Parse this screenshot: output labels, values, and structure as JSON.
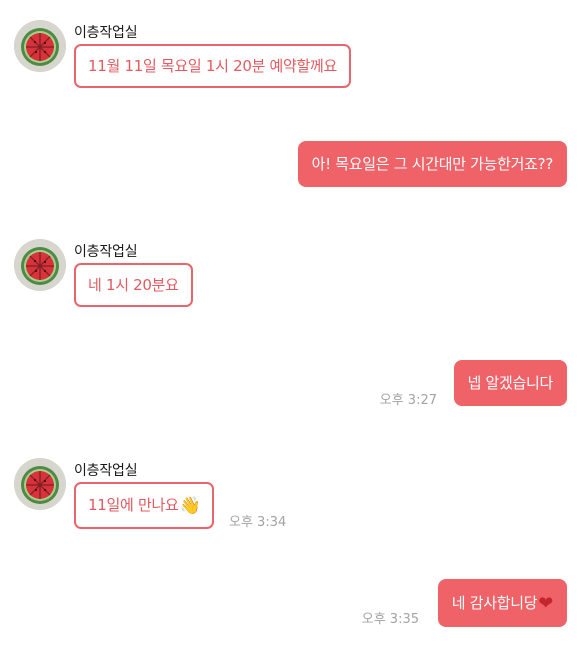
{
  "chat": {
    "sender_name": "이층작업실",
    "messages": [
      {
        "direction": "in",
        "text": "11월 11일 목요일 1시 20분 예약할께요",
        "time": ""
      },
      {
        "direction": "out",
        "text": "아! 목요일은 그 시간대만 가능한거죠??",
        "time": ""
      },
      {
        "direction": "in",
        "text": "네 1시 20분요",
        "time": ""
      },
      {
        "direction": "out",
        "text": "넵 알겠습니다",
        "time": "오후 3:27"
      },
      {
        "direction": "in",
        "text": "11일에 만나요",
        "emoji": "👋",
        "time": "오후 3:34"
      },
      {
        "direction": "out",
        "text": "네 감사합니당",
        "emoji": "❤",
        "time": "오후 3:35"
      }
    ]
  },
  "icons": {
    "avatar": "watermelon-profile-photo",
    "wave": "waving-hand-emoji",
    "heart": "red-heart-emoji"
  },
  "colors": {
    "outgoing_bubble": "#ee6268",
    "incoming_border": "#e8666b",
    "incoming_text": "#e35a60",
    "timestamp": "#a3a3a3"
  }
}
